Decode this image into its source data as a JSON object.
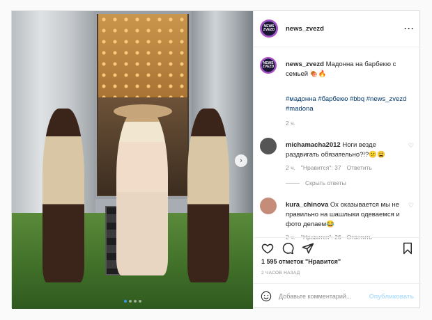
{
  "post": {
    "username": "news_zvezd",
    "avatar_text": "NEWS ZVEZD",
    "more_icon": "more-horizontal-icon",
    "caption": {
      "username": "news_zvezd",
      "text": "Мадонна на барбекю с семьей 🍖🔥",
      "hashtags": [
        "#мадонна",
        "#барбекю",
        "#bbq",
        "#news_zvezd",
        "#madona"
      ],
      "time": "2 ч."
    },
    "comments": [
      {
        "username": "michamacha2012",
        "text": "Ноги везде раздвигать обязательно?!?😕😩",
        "time": "2 ч.",
        "likes": "\"Нравится\": 37",
        "reply": "Ответить",
        "avatar_color": "#555555"
      },
      {
        "username": "kura_chinova",
        "text": "Ох оказывается мы не правильно на шашлыки одеваемся и фото делаем😂",
        "time": "2 ч.",
        "likes": "\"Нравится\": 26",
        "reply": "Ответить",
        "avatar_color": "#c58c7a"
      }
    ],
    "hide_replies": "Скрыть ответы",
    "likes_line": "1 595 отметок \"Нравится\"",
    "date": "2 ЧАСОВ НАЗАД",
    "add_comment": {
      "placeholder": "Добавьте комментарий...",
      "publish": "Опубликовать"
    }
  },
  "carousel": {
    "total": 4,
    "active": 0
  },
  "colors": {
    "link": "#00376b",
    "muted": "#8e8e8e",
    "publish_disabled": "#b2dffc",
    "border": "#dbdbdb"
  }
}
